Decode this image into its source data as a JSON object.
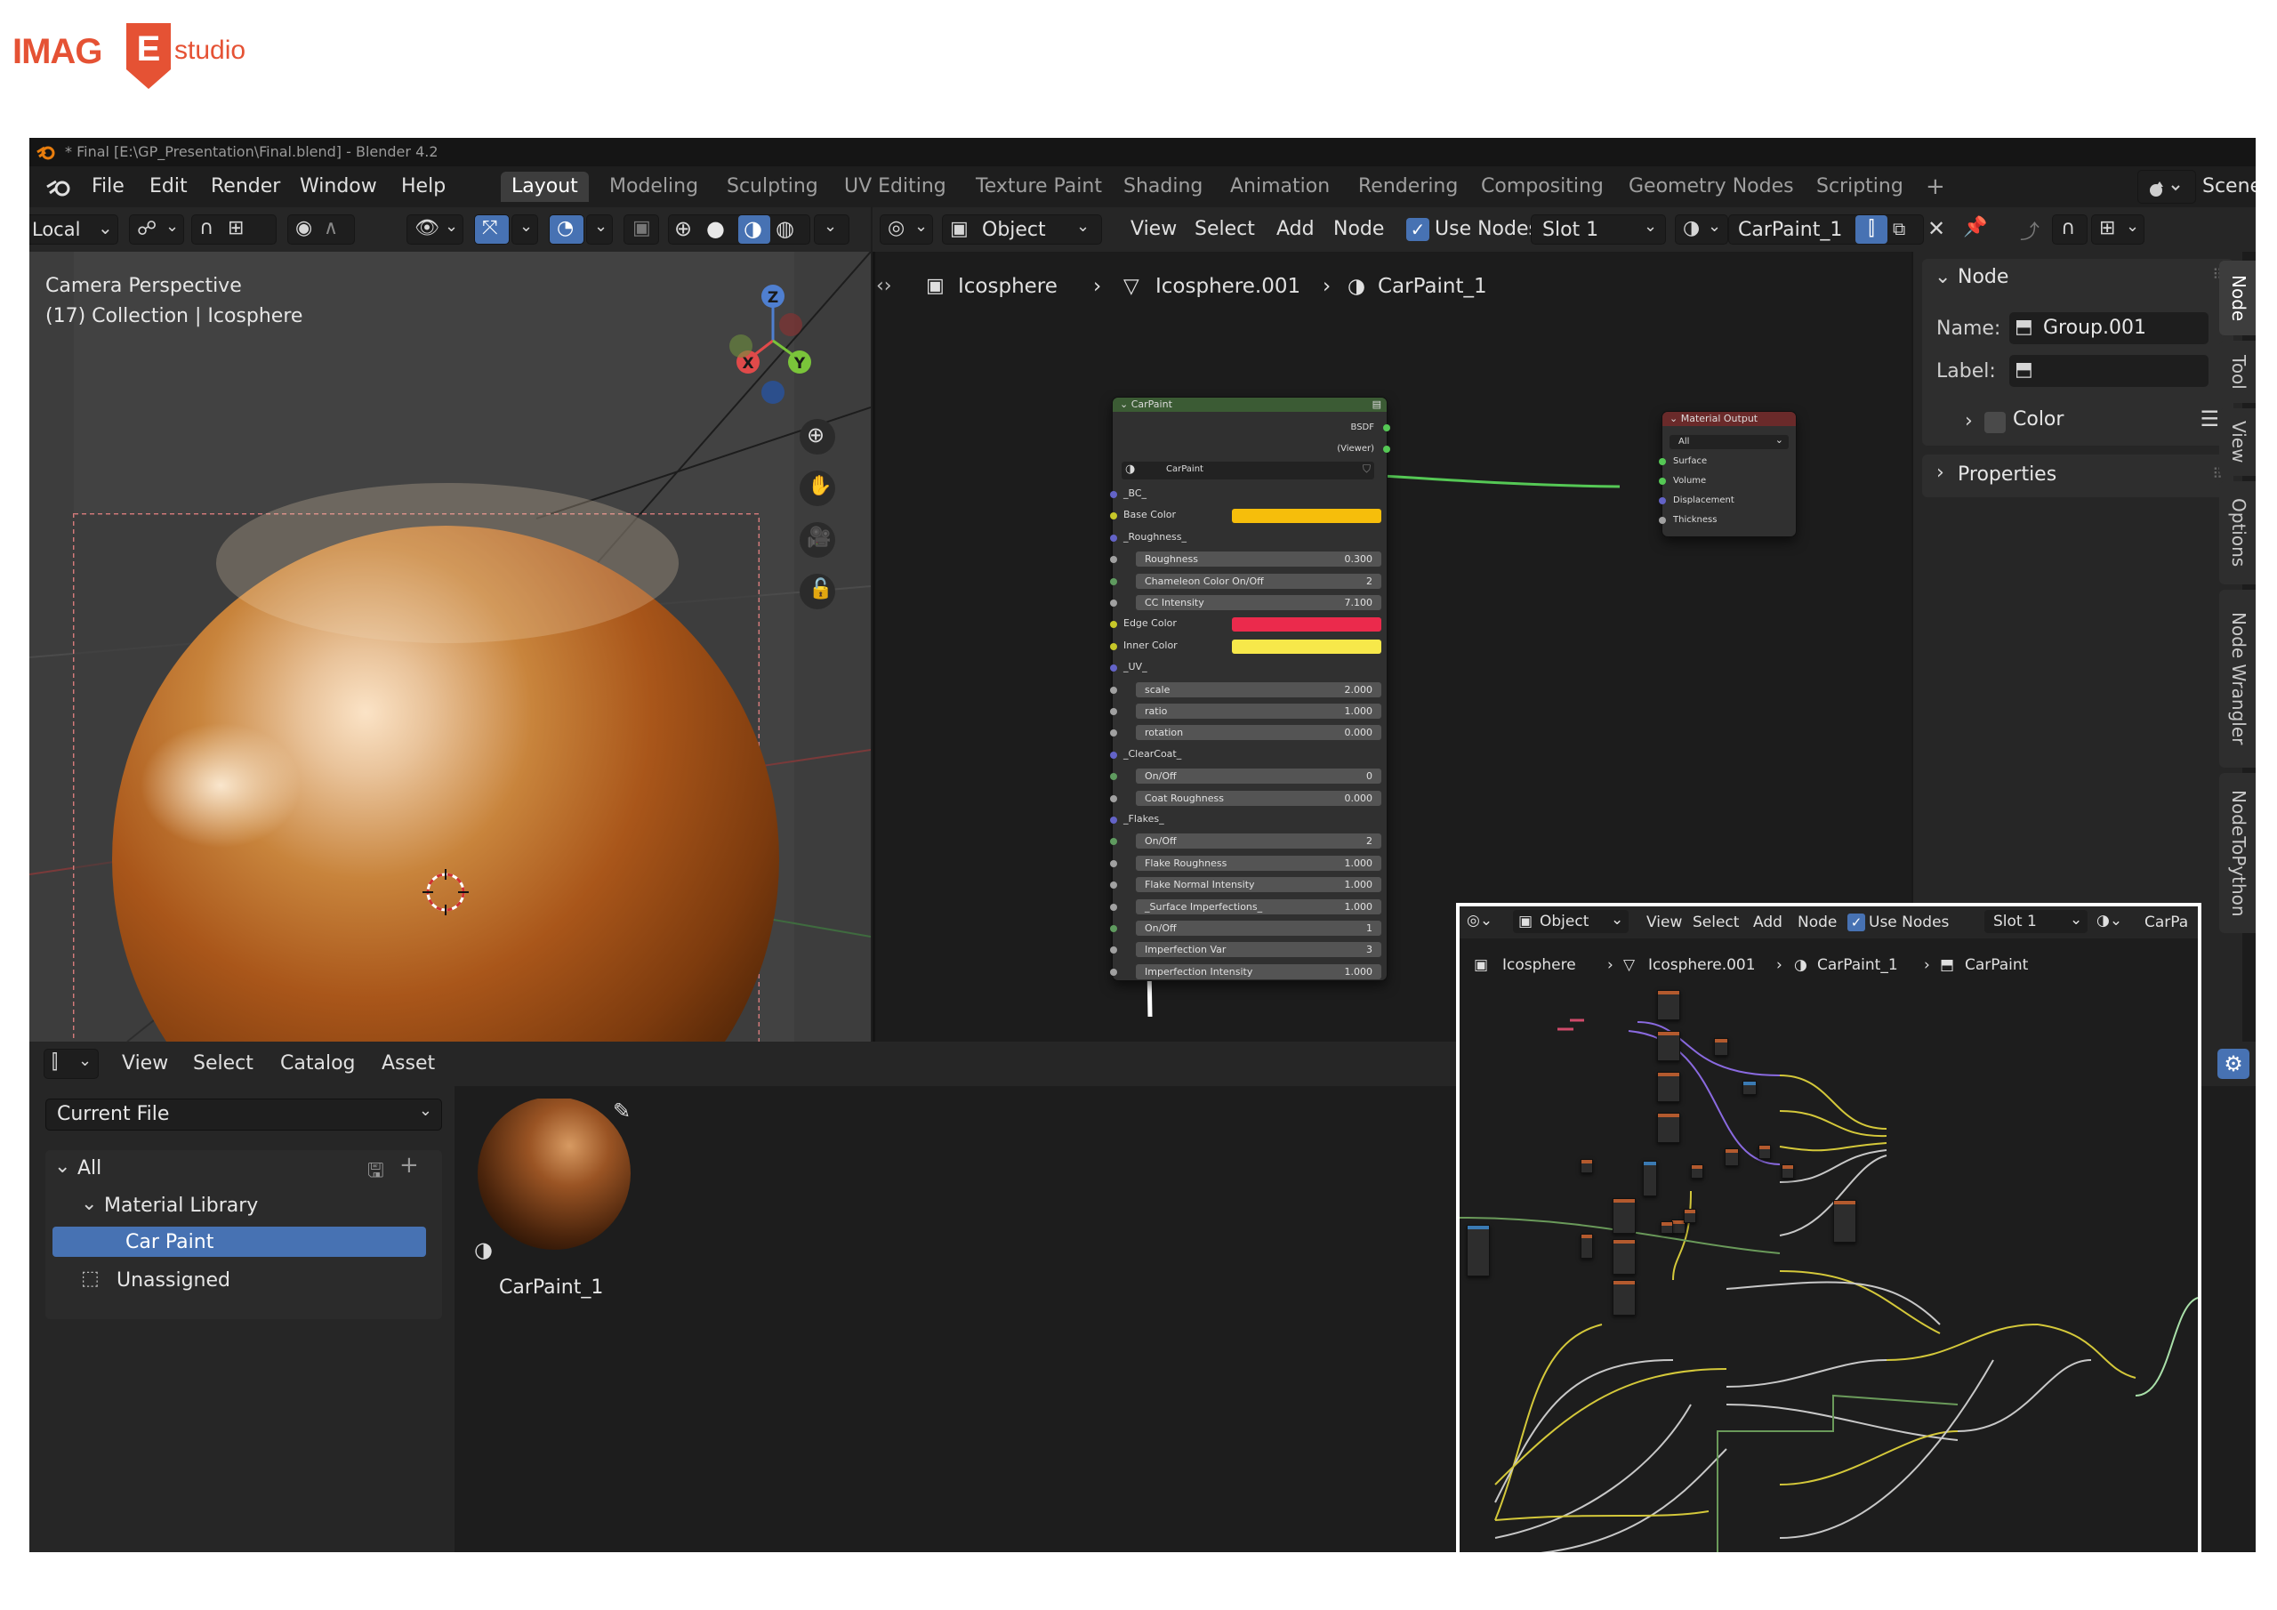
{
  "brand": {
    "name_left": "IMAG",
    "name_mark": "E",
    "name_right": "studio"
  },
  "window": {
    "title": "* Final [E:\\GP_Presentation\\Final.blend] - Blender 4.2"
  },
  "menu": {
    "items": [
      "File",
      "Edit",
      "Render",
      "Window",
      "Help"
    ]
  },
  "workspaces": {
    "tabs": [
      "Layout",
      "Modeling",
      "Sculpting",
      "UV Editing",
      "Texture Paint",
      "Shading",
      "Animation",
      "Rendering",
      "Compositing",
      "Geometry Nodes",
      "Scripting"
    ],
    "active": "Layout",
    "scene_label": "Scene"
  },
  "viewport": {
    "transform_orientation": "Local",
    "overlay_line1": "Camera Perspective",
    "overlay_line2": "(17) Collection | Icosphere",
    "gizmo": {
      "z": "Z",
      "x": "X",
      "y": "Y"
    }
  },
  "node_editor": {
    "header": {
      "mode": "Object",
      "menu": [
        "View",
        "Select",
        "Add",
        "Node"
      ],
      "use_nodes_label": "Use Nodes",
      "slot": "Slot 1",
      "material": "CarPaint_1"
    },
    "breadcrumb": [
      "Icosphere",
      "Icosphere.001",
      "CarPaint_1"
    ],
    "group_node": {
      "title": "CarPaint",
      "out_bsdf": "BSDF",
      "out_viewer": "(Viewer)",
      "group_name": "CarPaint",
      "rows": [
        {
          "type": "label",
          "text": "_BC_",
          "sock": "#6363c7"
        },
        {
          "type": "color",
          "text": "Base Color",
          "sock": "#c7c729",
          "color": "#f6be0b"
        },
        {
          "type": "label",
          "text": "_Roughness_",
          "sock": "#6363c7"
        },
        {
          "type": "value",
          "text": "Roughness",
          "value": "0.300",
          "sock": "#a1a1a1"
        },
        {
          "type": "value",
          "text": "Chameleon Color On/Off",
          "value": "2",
          "sock": "#5f9b5f"
        },
        {
          "type": "value",
          "text": "CC Intensity",
          "value": "7.100",
          "sock": "#a1a1a1"
        },
        {
          "type": "color",
          "text": "Edge Color",
          "sock": "#c7c729",
          "color": "#eb2a4c"
        },
        {
          "type": "color",
          "text": "Inner Color",
          "sock": "#c7c729",
          "color": "#f7e84a"
        },
        {
          "type": "label",
          "text": "_UV_",
          "sock": "#6363c7"
        },
        {
          "type": "value",
          "text": "scale",
          "value": "2.000",
          "sock": "#a1a1a1"
        },
        {
          "type": "value",
          "text": "ratio",
          "value": "1.000",
          "sock": "#a1a1a1"
        },
        {
          "type": "value",
          "text": "rotation",
          "value": "0.000",
          "sock": "#a1a1a1"
        },
        {
          "type": "label",
          "text": "_ClearCoat_",
          "sock": "#6363c7"
        },
        {
          "type": "value",
          "text": "On/Off",
          "value": "0",
          "sock": "#5f9b5f"
        },
        {
          "type": "value",
          "text": "Coat Roughness",
          "value": "0.000",
          "sock": "#a1a1a1"
        },
        {
          "type": "label",
          "text": "_Flakes_",
          "sock": "#6363c7"
        },
        {
          "type": "value",
          "text": "On/Off",
          "value": "2",
          "sock": "#5f9b5f"
        },
        {
          "type": "value",
          "text": "Flake Roughness",
          "value": "1.000",
          "sock": "#a1a1a1"
        },
        {
          "type": "value",
          "text": "Flake Normal Intensity",
          "value": "1.000",
          "sock": "#a1a1a1"
        },
        {
          "type": "value",
          "text": "_Surface Imperfections_",
          "value": "1.000",
          "sock": "#a1a1a1"
        },
        {
          "type": "value",
          "text": "On/Off",
          "value": "1",
          "sock": "#5f9b5f"
        },
        {
          "type": "value",
          "text": "Imperfection Var",
          "value": "3",
          "sock": "#a1a1a1"
        },
        {
          "type": "value",
          "text": "Imperfection Intensity",
          "value": "1.000",
          "sock": "#a1a1a1"
        }
      ]
    },
    "output_node": {
      "title": "Material Output",
      "target": "All",
      "sockets": [
        "Surface",
        "Volume",
        "Displacement",
        "Thickness"
      ]
    }
  },
  "sidebar": {
    "node_panel": "Node",
    "name_label": "Name:",
    "name_value": "Group.001",
    "label_label": "Label:",
    "label_value": "",
    "color_label": "Color",
    "properties_label": "Properties",
    "tabs": [
      "Node",
      "Tool",
      "View",
      "Options",
      "Node Wrangler",
      "NodeToPython"
    ]
  },
  "asset_browser": {
    "menu": [
      "View",
      "Select",
      "Catalog",
      "Asset"
    ],
    "library": "Current File",
    "tree": {
      "all": "All",
      "material_library": "Material Library",
      "car_paint": "Car Paint",
      "unassigned": "Unassigned"
    },
    "asset_name": "CarPaint_1"
  },
  "inset": {
    "header": {
      "mode": "Object",
      "menu": [
        "View",
        "Select",
        "Add",
        "Node"
      ],
      "use_nodes_label": "Use Nodes",
      "slot": "Slot 1",
      "material_short": "CarPa"
    },
    "breadcrumb": [
      "Icosphere",
      "Icosphere.001",
      "CarPaint_1",
      "CarPaint"
    ]
  },
  "colors": {
    "accent_blue": "#4772b3",
    "brand_orange": "#e55234",
    "link_green": "#55c855"
  }
}
